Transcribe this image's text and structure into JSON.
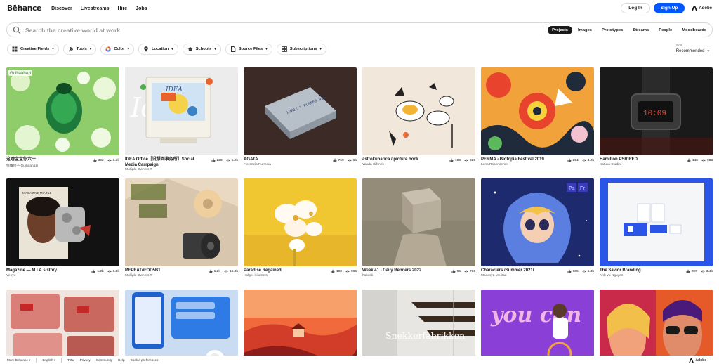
{
  "nav": {
    "logo": "Bēhance",
    "links": [
      "Discover",
      "Livestreams",
      "Hire",
      "Jobs"
    ],
    "login": "Log In",
    "signup": "Sign Up",
    "adobe": "Adobe"
  },
  "search": {
    "placeholder": "Search the creative world at work",
    "scopes": [
      "Projects",
      "Images",
      "Prototypes",
      "Streams",
      "People",
      "Moodboards"
    ],
    "active_scope": "Projects"
  },
  "filters": [
    "Creative Fields",
    "Tools",
    "Color",
    "Location",
    "Schools",
    "Source Files",
    "Subscriptions"
  ],
  "sort": {
    "label": "Sort",
    "value": "Recommended"
  },
  "projects": [
    {
      "title": "这啥宝宝你六一",
      "owner": "兔角团子 Guihaahazi",
      "likes": "332",
      "views": "3.3k"
    },
    {
      "title": "IDEA Office［设想到事务所］Social Media Campaign",
      "owner": "Multiple Owners ▾",
      "likes": "228",
      "views": "1.2k"
    },
    {
      "title": "AGATA",
      "owner": "Florencia Purrecia",
      "likes": "769",
      "views": "6k"
    },
    {
      "title": "astrokuharica / picture book",
      "owner": "Vanda Čižmek",
      "likes": "103",
      "views": "928"
    },
    {
      "title": "PERMA - Biotopia Festival 2019",
      "owner": "Lena Rosendemel",
      "likes": "294",
      "views": "3.2k"
    },
    {
      "title": "Hamilton PSR RED",
      "owner": "Katuko Studio",
      "likes": "146",
      "views": "983"
    },
    {
      "title": "Magazine — M.I.A.s story",
      "owner": "Venya",
      "likes": "1.2k",
      "views": "6.8k"
    },
    {
      "title": "REPEAT#FDD5B1",
      "owner": "Multiple Owners ▾",
      "likes": "1.2k",
      "views": "16.8k"
    },
    {
      "title": "Paradise Regained",
      "owner": "Holger Kilumets",
      "likes": "108",
      "views": "995"
    },
    {
      "title": "Week 41 - Daily Renders 2022",
      "owner": "hallesb",
      "likes": "96",
      "views": "710"
    },
    {
      "title": "Characters /Summer 2021/",
      "owner": "Manasya Meritaz",
      "likes": "965",
      "views": "5.8k"
    },
    {
      "title": "The Savior Branding",
      "owner": "Anh Vu Nguyen",
      "likes": "287",
      "views": "3.4k"
    },
    {
      "title": "",
      "owner": "",
      "likes": "",
      "views": ""
    },
    {
      "title": "",
      "owner": "",
      "likes": "",
      "views": ""
    },
    {
      "title": "",
      "owner": "",
      "likes": "",
      "views": ""
    },
    {
      "title": "",
      "owner": "",
      "likes": "",
      "views": ""
    },
    {
      "title": "",
      "owner": "",
      "likes": "",
      "views": ""
    },
    {
      "title": "",
      "owner": "",
      "likes": "",
      "views": ""
    }
  ],
  "thumb_texts": {
    "card0_tag": "Guihaahazi",
    "card1_word": "IDEA",
    "card2_box": "LOPEZ Y PLANES 919",
    "card6_mag": "MAGAZINE MIA №1",
    "card15_word": "Snekkerfabrikken",
    "card16_word": "you can",
    "card10_badge1": "Ps",
    "card10_badge2": "Fr"
  },
  "footer": {
    "more": "More Behance ▾",
    "lang": "English ▾",
    "links": [
      "TOU",
      "Privacy",
      "Community",
      "Help",
      "Cookie preferences"
    ],
    "adobe": "Adobe"
  },
  "colors": {
    "accent": "#0057ff",
    "active_scope": "#191919"
  }
}
